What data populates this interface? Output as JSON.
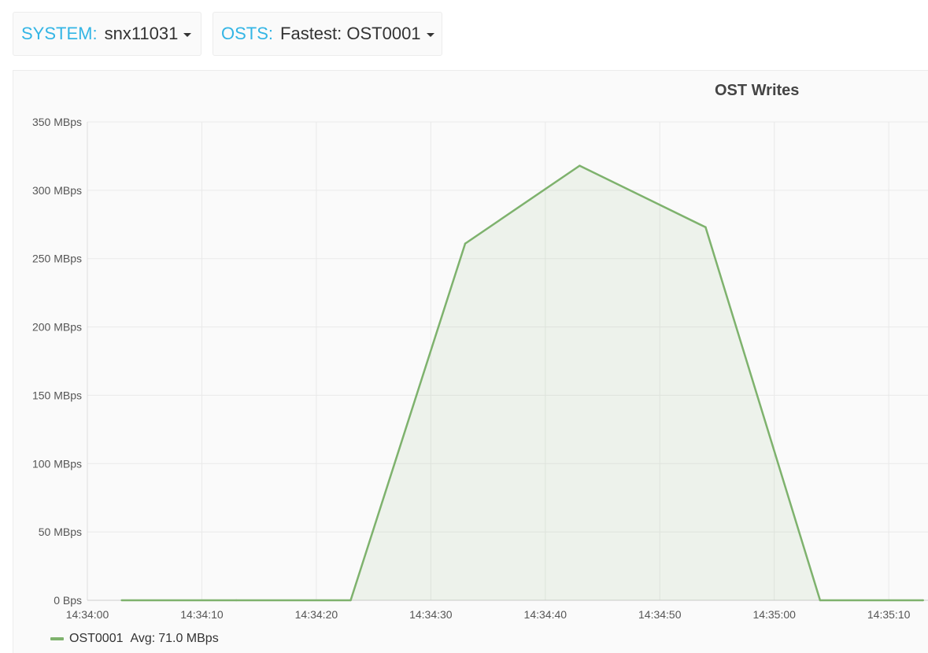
{
  "variables": {
    "system": {
      "label": "SYSTEM:",
      "value": "snx11031"
    },
    "osts": {
      "label": "OSTS:",
      "value": "Fastest: OST0001"
    }
  },
  "panel": {
    "title": "OST Writes"
  },
  "legend": {
    "series_name": "OST0001",
    "avg_label": "Avg:",
    "avg_value": "71.0 MBps"
  },
  "colors": {
    "accent": "#33b5e5",
    "series_line": "#7eb26d",
    "series_fill": "#7eb26d"
  },
  "chart_data": {
    "type": "area",
    "title": "OST Writes",
    "y_tick_labels": [
      "0 Bps",
      "50 MBps",
      "100 MBps",
      "150 MBps",
      "200 MBps",
      "250 MBps",
      "300 MBps",
      "350 MBps"
    ],
    "y_ticks": [
      0,
      50,
      100,
      150,
      200,
      250,
      300,
      350
    ],
    "ylim": [
      0,
      350
    ],
    "y_unit": "MBps",
    "x_tick_labels": [
      "14:34:00",
      "14:34:10",
      "14:34:20",
      "14:34:30",
      "14:34:40",
      "14:34:50",
      "14:35:00",
      "14:35:10"
    ],
    "x_ticks": [
      "14:34:00",
      "14:34:10",
      "14:34:20",
      "14:34:30",
      "14:34:40",
      "14:34:50",
      "14:35:00",
      "14:35:10"
    ],
    "xlim": [
      "14:34:00",
      "14:35:13"
    ],
    "grid": true,
    "legend_position": "bottom-left",
    "series": [
      {
        "name": "OST0001",
        "x": [
          "14:34:03",
          "14:34:13",
          "14:34:23",
          "14:34:33",
          "14:34:43",
          "14:34:54",
          "14:35:04",
          "14:35:13"
        ],
        "y": [
          0,
          0,
          0,
          261,
          318,
          273,
          0,
          0
        ]
      }
    ]
  }
}
